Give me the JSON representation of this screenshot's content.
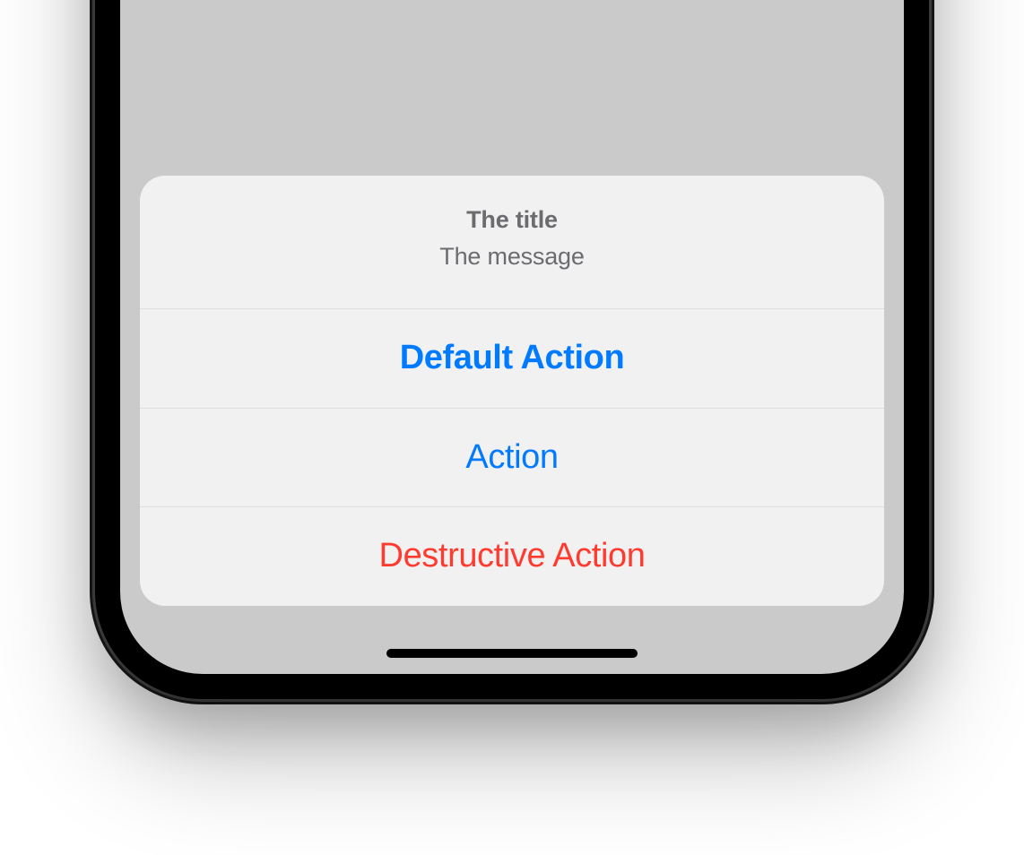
{
  "actionSheet": {
    "title": "The title",
    "message": "The message",
    "actions": {
      "default": "Default Action",
      "normal": "Action",
      "destructive": "Destructive Action"
    }
  },
  "colors": {
    "tint": "#007AFF",
    "destructive": "#FF3B30",
    "secondary": "#6b6b70",
    "sheetBackground": "#f2f2f4"
  }
}
